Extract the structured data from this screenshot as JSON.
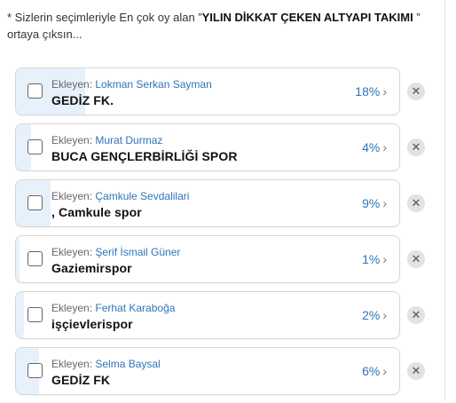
{
  "prompt": {
    "prefix": "* Sizlerin seçimleriyle En çok oy alan ”",
    "highlight": "YILIN DİKKAT ÇEKEN ALTYAPI TAKIMI",
    "suffix": " ” ortaya çıksın..."
  },
  "added_by_label": "Ekleyen: ",
  "chevron_glyph": "›",
  "remove_glyph": "✕",
  "colors": {
    "accent": "#2f74b8",
    "fill": "#e7f1fb",
    "remove_bg": "#e2e2e2"
  },
  "options": [
    {
      "author": "Lokman Serkan Sayman",
      "name": "GEDİZ FK.",
      "percent": "18%",
      "share": 0.18
    },
    {
      "author": "Murat Durmaz",
      "name": "BUCA GENÇLERBİRLİĞİ SPOR",
      "percent": "4%",
      "share": 0.04
    },
    {
      "author": "Çamkule Sevdalilari",
      "name": ", Camkule spor",
      "percent": "9%",
      "share": 0.09
    },
    {
      "author": "Şerif İsmail Güner",
      "name": "Gaziemirspor",
      "percent": "1%",
      "share": 0.01
    },
    {
      "author": "Ferhat Karaboğa",
      "name": "işçievlerispor",
      "percent": "2%",
      "share": 0.02
    },
    {
      "author": "Selma Baysal",
      "name": "GEDİZ FK",
      "percent": "6%",
      "share": 0.06
    }
  ]
}
